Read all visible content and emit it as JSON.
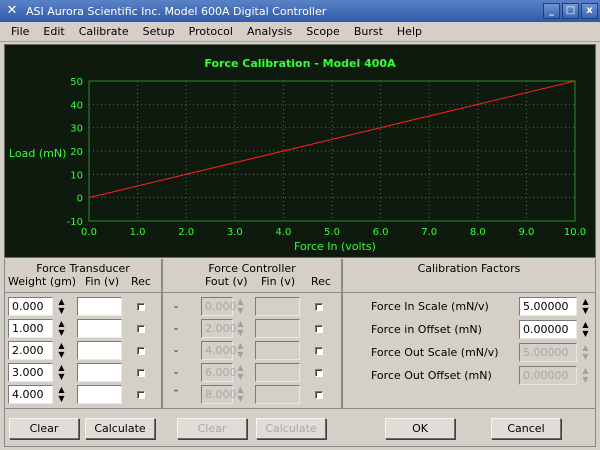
{
  "window": {
    "title": "ASI Aurora Scientific Inc.  Model 600A Digital Controller",
    "controls": [
      "_",
      "□",
      "x"
    ]
  },
  "menu": [
    "File",
    "Edit",
    "Calibrate",
    "Setup",
    "Protocol",
    "Analysis",
    "Scope",
    "Burst",
    "Help"
  ],
  "chart_data": {
    "type": "line",
    "title": "Force Calibration  - Model 400A",
    "xlabel": "Force In (volts)",
    "ylabel": "Load (mN)",
    "xlim": [
      0,
      10
    ],
    "ylim": [
      -10,
      50
    ],
    "xticks": [
      "0.0",
      "1.0",
      "2.0",
      "3.0",
      "4.0",
      "5.0",
      "6.0",
      "7.0",
      "8.0",
      "9.0",
      "10.0"
    ],
    "yticks": [
      "-10",
      "0",
      "10",
      "20",
      "30",
      "40",
      "50"
    ],
    "grid": true,
    "series": [
      {
        "x": [
          0,
          10
        ],
        "y": [
          0,
          50
        ],
        "color": "#ff2020"
      }
    ],
    "colors": {
      "background": "#0e1a0e",
      "text": "#33ff33",
      "grid": "#2e8b2e",
      "line": "#ff2020"
    }
  },
  "force_transducer": {
    "title": "Force Transducer",
    "headers": {
      "weight": "Weight (gm)",
      "fin": "Fin (v)",
      "rec": "Rec"
    },
    "rows": [
      {
        "weight": "0.000",
        "fin": ""
      },
      {
        "weight": "1.000",
        "fin": ""
      },
      {
        "weight": "2.000",
        "fin": ""
      },
      {
        "weight": "3.000",
        "fin": ""
      },
      {
        "weight": "4.000",
        "fin": ""
      }
    ],
    "clear_label": "Clear",
    "calculate_label": "Calculate"
  },
  "force_controller": {
    "title": "Force Controller",
    "headers": {
      "fout": "Fout (v)",
      "fin": "Fin (v)",
      "rec": "Rec"
    },
    "rows": [
      {
        "fout": "0.000",
        "fin": ""
      },
      {
        "fout": "2.000",
        "fin": ""
      },
      {
        "fout": "4.000",
        "fin": ""
      },
      {
        "fout": "6.000",
        "fin": ""
      },
      {
        "fout": "8.000",
        "fin": ""
      }
    ],
    "clear_label": "Clear",
    "calculate_label": "Calculate"
  },
  "calibration_factors": {
    "title": "Calibration Factors",
    "rows": [
      {
        "label": "Force In Scale    (mN/v)",
        "value": "5.00000"
      },
      {
        "label": "Force in Offset      (mN)",
        "value": "0.00000"
      },
      {
        "label": "Force Out Scale (mN/v)",
        "value": "5.00000"
      },
      {
        "label": "Force Out Offset (mN)",
        "value": "0.00000"
      }
    ]
  },
  "actions": {
    "ok_label": "OK",
    "cancel_label": "Cancel"
  }
}
